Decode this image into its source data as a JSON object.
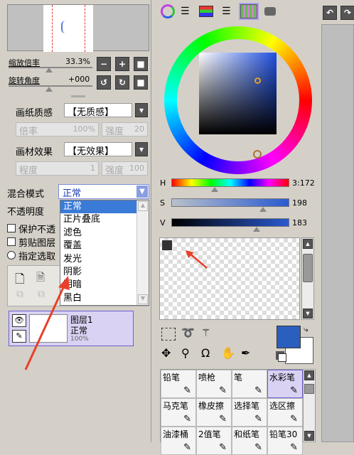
{
  "nav": {
    "zoom_label": "缩放倍率",
    "zoom_value": "33.3%",
    "rotate_label": "旋转角度",
    "rotate_value": "+000",
    "nav_buttons": [
      "minus",
      "plus",
      "reset",
      "rotate-left",
      "rotate-right",
      "rotate-reset"
    ]
  },
  "paper": {
    "label": "画纸质感",
    "value": "【无质感】",
    "rate_label": "倍率",
    "rate_value": "100%",
    "strength_label": "强度",
    "strength_value": "20"
  },
  "effect": {
    "label": "画材效果",
    "value": "【无效果】",
    "level_label": "程度",
    "level_value": "1",
    "strength_label": "强度",
    "strength_value": "100"
  },
  "blend": {
    "label": "混合模式",
    "value": "正常",
    "opacity_label": "不透明度",
    "options": [
      "正常",
      "正片叠底",
      "滤色",
      "覆盖",
      "发光",
      "阴影",
      "明暗",
      "黑白"
    ]
  },
  "checks": {
    "protect": "保护不透",
    "clip": "剪贴图层",
    "select_source": "指定选取"
  },
  "layer": {
    "name": "图层1",
    "mode": "正常",
    "opacity": "100%"
  },
  "color": {
    "h_label": "H",
    "h_value": "3:172",
    "s_label": "S",
    "s_value": "198",
    "v_label": "V",
    "v_value": "183",
    "h_frac": 0.37,
    "s_frac": 0.78,
    "v_frac": 0.72,
    "fg": "#2b5fbd",
    "bg": "#ffffff"
  },
  "tools": {
    "row1": [
      "铅笔",
      "喷枪",
      "笔",
      "水彩笔"
    ],
    "row2": [
      "马克笔",
      "橡皮擦",
      "选择笔",
      "选区擦"
    ],
    "row3": [
      "油漆桶",
      "2值笔",
      "和纸笔",
      "铅笔30"
    ]
  }
}
